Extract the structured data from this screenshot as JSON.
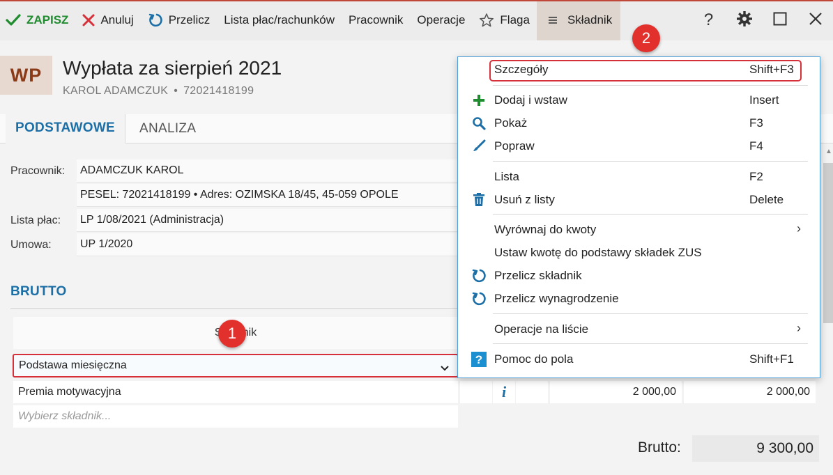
{
  "toolbar": {
    "save": "ZAPISZ",
    "cancel": "Anuluj",
    "recalc": "Przelicz",
    "payroll_list": "Lista płac/rachunków",
    "employee": "Pracownik",
    "operations": "Operacje",
    "flag": "Flaga",
    "component": "Składnik",
    "help_glyph": "?"
  },
  "header": {
    "badge": "WP",
    "title": "Wypłata za sierpień 2021",
    "employee_name": "KAROL ADAMCZUK",
    "separator": "•",
    "pesel": "72021418199"
  },
  "tabs": [
    {
      "label": "PODSTAWOWE",
      "active": true
    },
    {
      "label": "ANALIZA",
      "active": false
    }
  ],
  "form": {
    "employee_label": "Pracownik:",
    "employee_value": "ADAMCZUK KAROL",
    "details_value": "PESEL:  72021418199  •  Adres:  OZIMSKA 18/45, 45-059 OPOLE",
    "payroll_label": "Lista płac:",
    "payroll_value": "LP 1/08/2021 (Administracja)",
    "contract_label": "Umowa:",
    "contract_value": "UP 1/2020"
  },
  "gross": {
    "section_title": "BRUTTO",
    "column_header": "Składnik",
    "rows": [
      {
        "name": "Podstawa miesięczna",
        "selected": true
      },
      {
        "name": "Premia motywacyjna",
        "info": "i",
        "amount1": "2 000,00",
        "amount2": "2 000,00"
      }
    ],
    "placeholder": "Wybierz składnik...",
    "total_label": "Brutto:",
    "total_value": "9 300,00"
  },
  "callouts": [
    "1",
    "2"
  ],
  "context_menu": {
    "items": [
      {
        "label": "Szczegóły",
        "shortcut": "Shift+F3",
        "icon": "none",
        "highlighted": true
      },
      {
        "label": "Dodaj i wstaw",
        "shortcut": "Insert",
        "icon": "plus-icon"
      },
      {
        "label": "Pokaż",
        "shortcut": "F3",
        "icon": "magnifier-icon"
      },
      {
        "label": "Popraw",
        "shortcut": "F4",
        "icon": "brush-icon"
      },
      {
        "label": "Lista",
        "shortcut": "F2",
        "icon": "none"
      },
      {
        "label": "Usuń z listy",
        "shortcut": "Delete",
        "icon": "trash-icon"
      },
      {
        "label": "Wyrównaj do kwoty",
        "shortcut": "",
        "icon": "none",
        "submenu": "›"
      },
      {
        "label": "Ustaw kwotę do podstawy składek ZUS",
        "shortcut": "",
        "icon": "none"
      },
      {
        "label": "Przelicz składnik",
        "shortcut": "",
        "icon": "refresh-icon"
      },
      {
        "label": "Przelicz wynagrodzenie",
        "shortcut": "",
        "icon": "refresh-icon"
      },
      {
        "label": "Operacje na liście",
        "shortcut": "",
        "icon": "none",
        "submenu": "›"
      },
      {
        "label": "Pomoc do pola",
        "shortcut": "Shift+F1",
        "icon": "help-icon"
      }
    ]
  },
  "colors": {
    "accent_blue": "#1c6fa6",
    "save_green": "#1f8c2f",
    "cancel_red": "#d6303b",
    "callout_red": "#e2312d",
    "badge_bg": "#e7d8d0"
  }
}
